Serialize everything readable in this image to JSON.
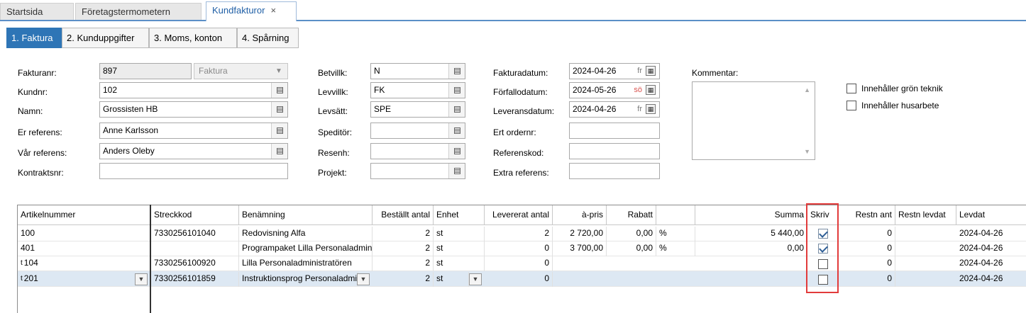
{
  "doc_tabs": [
    {
      "label": "Startsida"
    },
    {
      "label": "Företagstermometern"
    },
    {
      "label": "Kundfakturor",
      "close": "×"
    }
  ],
  "sub_tabs": [
    "1. Faktura",
    "2. Kunduppgifter",
    "3. Moms, konton",
    "4. Spårning"
  ],
  "form": {
    "fakturanr_label": "Fakturanr:",
    "fakturanr": "897",
    "doc_type": "Faktura",
    "kundnr_label": "Kundnr:",
    "kundnr": "102",
    "namn_label": "Namn:",
    "namn": "Grossisten HB",
    "er_referens_label": "Er referens:",
    "er_referens": "Anne Karlsson",
    "var_referens_label": "Vår referens:",
    "var_referens": "Anders Oleby",
    "kontraktsnr_label": "Kontraktsnr:",
    "kontraktsnr": "",
    "betvillk_label": "Betvillk:",
    "betvillk": "N",
    "levvillk_label": "Levvillk:",
    "levvillk": "FK",
    "levsatt_label": "Levsätt:",
    "levsatt": "SPE",
    "speditor_label": "Speditör:",
    "speditor": "",
    "resenh_label": "Resenh:",
    "resenh": "",
    "projekt_label": "Projekt:",
    "projekt": "",
    "fakturadatum_label": "Fakturadatum:",
    "fakturadatum": "2024-04-26",
    "fakturadatum_day": "fr",
    "forfallodatum_label": "Förfallodatum:",
    "forfallodatum": "2024-05-26",
    "forfallodatum_day": "sö",
    "leveransdatum_label": "Leveransdatum:",
    "leveransdatum": "2024-04-26",
    "leveransdatum_day": "fr",
    "ert_ordernr_label": "Ert ordernr:",
    "referenskod_label": "Referenskod:",
    "extra_referens_label": "Extra referens:",
    "kommentar_label": "Kommentar:",
    "gron_teknik_label": "Innehåller grön teknik",
    "husarbete_label": "Innehåller husarbete"
  },
  "grid": {
    "columns": [
      "Artikelnummer",
      "Streckkod",
      "Benämning",
      "Beställt antal",
      "Enhet",
      "Levererat antal",
      "à-pris",
      "Rabatt",
      "Summa",
      "Skriv",
      "Restn ant",
      "Restn levdat",
      "Levdat"
    ],
    "rows": [
      {
        "marker": "",
        "artnr": "100",
        "streckkod": "7330256101040",
        "benamning": "Redovisning Alfa",
        "bestallt": "2",
        "enhet": "st",
        "levererat": "2",
        "apris": "2 720,00",
        "rabatt": "0,00",
        "pct": "%",
        "summa": "5 440,00",
        "skriv": true,
        "restn_ant": "0",
        "levdat": "2024-04-26"
      },
      {
        "marker": "",
        "artnr": "401",
        "streckkod": "",
        "benamning": "Programpaket Lilla Personaladministratören",
        "bestallt": "2",
        "enhet": "st",
        "levererat": "0",
        "apris": "3 700,00",
        "rabatt": "0,00",
        "pct": "%",
        "summa": "0,00",
        "skriv": true,
        "restn_ant": "0",
        "levdat": "2024-04-26"
      },
      {
        "marker": "t",
        "artnr": "104",
        "streckkod": "7330256100920",
        "benamning": "Lilla Personaladministratören",
        "bestallt": "2",
        "enhet": "st",
        "levererat": "0",
        "apris": "",
        "rabatt": "",
        "pct": "",
        "summa": "",
        "skriv": false,
        "restn_ant": "0",
        "levdat": "2024-04-26"
      },
      {
        "marker": "t",
        "artnr": "201",
        "streckkod": "7330256101859",
        "benamning": "Instruktionsprog Personaladministratören",
        "bestallt": "2",
        "enhet": "st",
        "levererat": "0",
        "apris": "",
        "rabatt": "",
        "pct": "",
        "summa": "",
        "skriv": false,
        "restn_ant": "0",
        "levdat": "2024-04-26"
      }
    ]
  },
  "icons": {
    "lookup": "list-lookup-icon",
    "calendar": "calendar-icon",
    "dropdown": "chevron-down-icon"
  },
  "colors": {
    "accent": "#2e75b6",
    "highlight": "#e23b3b",
    "selected_row": "#dde8f3"
  }
}
